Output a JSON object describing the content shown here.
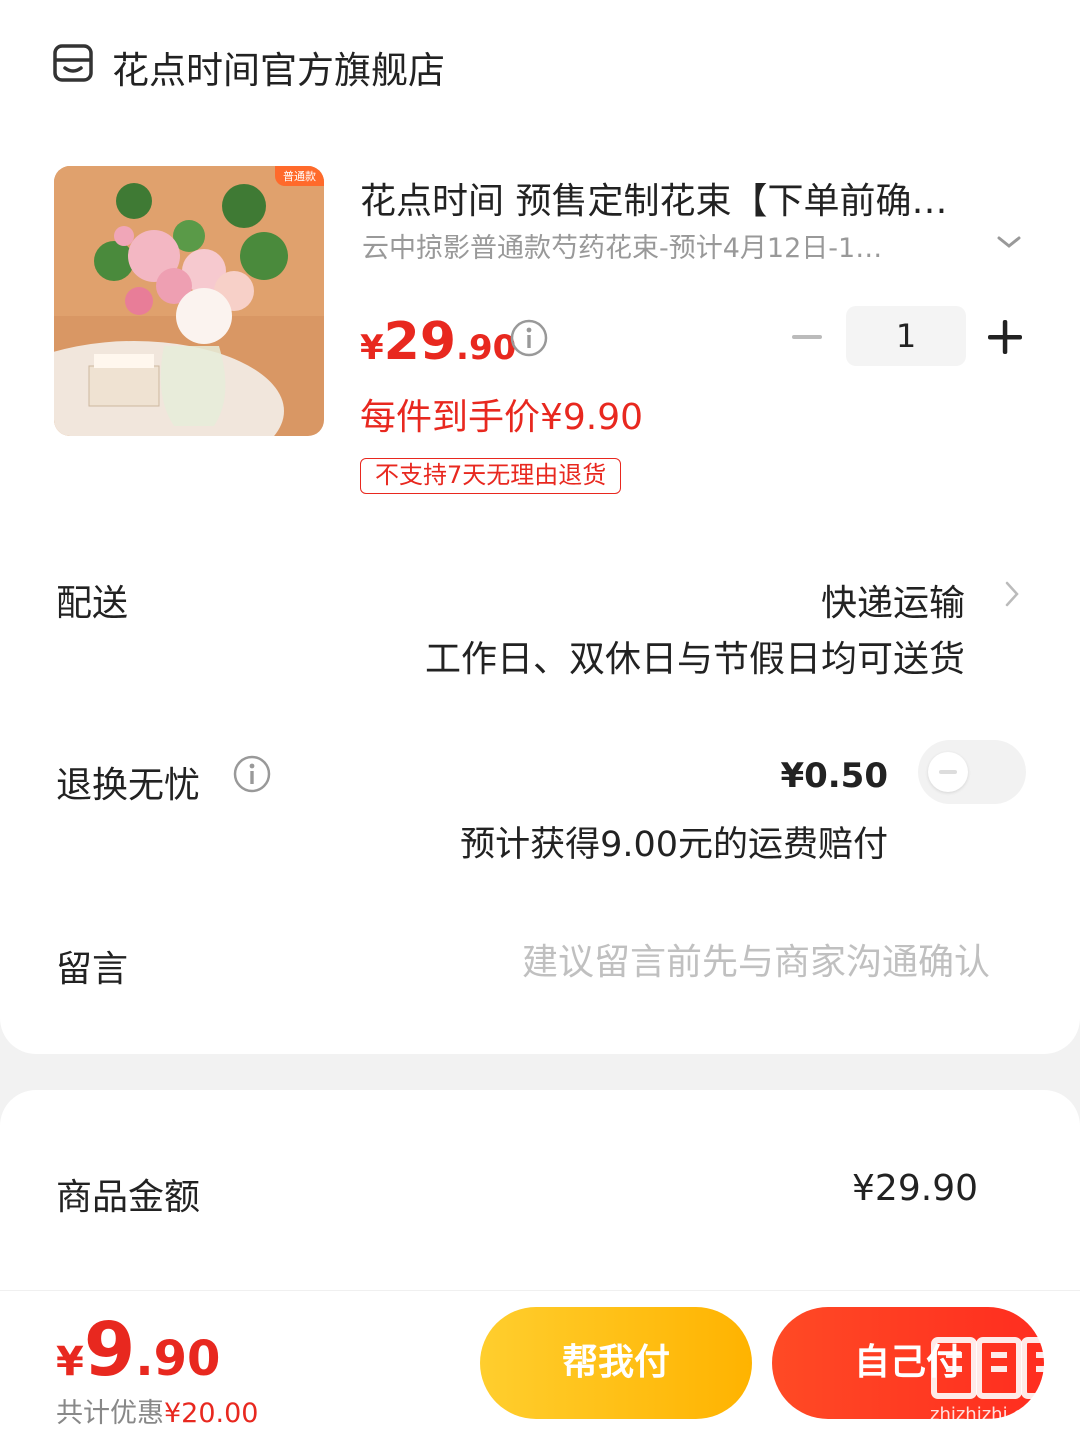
{
  "store": {
    "name": "花点时间官方旗舰店"
  },
  "product": {
    "thumb_tag": "普通款",
    "title": "花点时间 预售定制花束【下单前确…",
    "sku": "云中掠影普通款芍药花束-预计4月12日-1…",
    "price": {
      "currency": "¥",
      "integer": "29",
      "decimal": ".90"
    },
    "quantity": "1",
    "unit_price": "每件到手价¥9.90",
    "return_policy": "不支持7天无理由退货"
  },
  "delivery": {
    "label": "配送",
    "method": "快递运输",
    "desc": "工作日、双休日与节假日均可送货"
  },
  "return_insurance": {
    "label": "退换无忧",
    "price": "¥0.50",
    "desc": "预计获得9.00元的运费赔付",
    "enabled": false
  },
  "message": {
    "label": "留言",
    "placeholder": "建议留言前先与商家沟通确认"
  },
  "summary": {
    "amount_label": "商品金额",
    "amount_value": "¥29.90"
  },
  "bottom": {
    "total": {
      "currency": "¥",
      "integer": "9",
      "decimal": ".90"
    },
    "discount_label": "共计优惠",
    "discount_value": "¥20.00",
    "help_pay": "帮我付",
    "self_pay": "自己付"
  },
  "watermark": {
    "text": "zhizhizhi.com",
    "logo": "值值值"
  },
  "colors": {
    "accent": "#e8281f",
    "help_btn": "#ffc21a",
    "self_btn": "#ff3a22"
  }
}
